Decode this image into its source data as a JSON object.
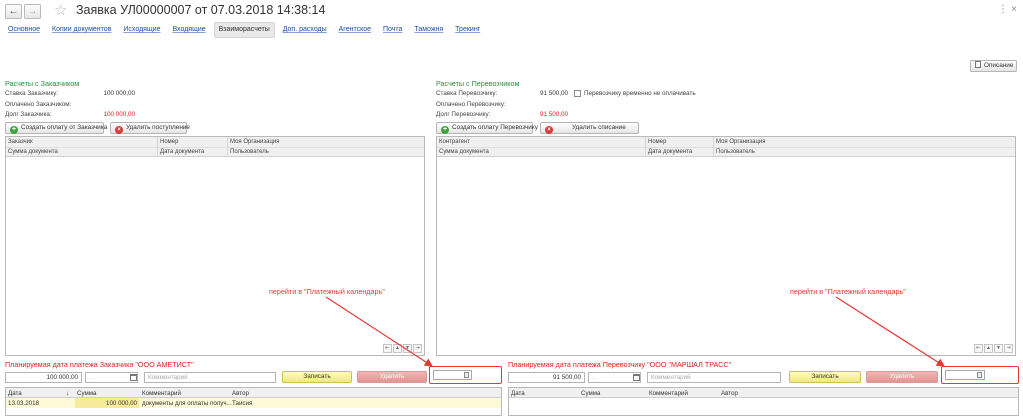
{
  "header": {
    "back_icon": "arrow-left-icon",
    "forward_icon": "arrow-right-icon",
    "title": "Заявка УЛ00000007 от 07.03.2018 14:38:14",
    "more_glyph": "⋮",
    "close_glyph": "×"
  },
  "tabs": [
    {
      "label": "Основное"
    },
    {
      "label": "Копии документов"
    },
    {
      "label": "Исходящие"
    },
    {
      "label": "Входящие"
    },
    {
      "label": "Взаиморасчеты",
      "active": true
    },
    {
      "label": "Доп. расходы"
    },
    {
      "label": "Агентское"
    },
    {
      "label": "Почта"
    },
    {
      "label": "Таможня"
    },
    {
      "label": "Трекинг"
    }
  ],
  "description_button": "Описание",
  "left": {
    "title": "Расчеты с Заказчиком",
    "rate_label": "Ставка Заказчику:",
    "rate_value": "100 000,00",
    "paid_label": "Оплачено Заказчиком:",
    "paid_value": "",
    "debt_label": "Долг Заказчика:",
    "debt_value": "100 000,00",
    "create_button": "Создать оплату от Заказчика",
    "delete_button": "Удалить поступление",
    "columns_top": [
      "Заказчик",
      "Номер",
      "Моя Организация"
    ],
    "columns_bottom": [
      "Сумма документа",
      "Дата документа",
      "Пользователь"
    ]
  },
  "right": {
    "title": "Расчеты с Перевозчиком",
    "rate_label": "Ставка Перевозчику:",
    "rate_value": "91 500,00",
    "checkbox_label": "Перевозчику временно не оплачивать",
    "paid_label": "Оплачено Перевозчику:",
    "paid_value": "",
    "debt_label": "Долг Перевозчику:",
    "debt_value": "91 500,00",
    "create_button": "Создать оплату Перевозчику",
    "delete_button": "Удалить списание",
    "columns_top": [
      "Контрагент",
      "Номер",
      "Моя Организация"
    ],
    "columns_bottom": [
      "Сумма документа",
      "Дата документа",
      "Пользователь"
    ]
  },
  "table_nav": [
    "⇤",
    "▲",
    "▼",
    "⇥"
  ],
  "annotations": {
    "left": "перейти в \"Платежный календарь\"",
    "right": "перейти в \"Платежный календарь\""
  },
  "pay_left": {
    "title": "Планируемая дата платежа Заказчика \"ООО АМЕТИСТ\"",
    "amount": "100 000,00",
    "date_placeholder": ". .",
    "comment_placeholder": "Комментарий",
    "save_button": "Записать",
    "delete_button": "Удалить",
    "columns": [
      "Дата",
      "Сумма",
      "Комментарий",
      "Автор"
    ],
    "sort_glyph": "↓",
    "rows": [
      {
        "date": "13.03.2018",
        "sum": "100 000,00",
        "comment": "документы для оплаты получ...",
        "author": "Таисия"
      }
    ]
  },
  "pay_right": {
    "title": "Планируемая дата платежа Перевозчику \"ООО \"МАРШАЛ ТРАСС\"",
    "amount": "91 500,00",
    "date_placeholder": ". .",
    "comment_placeholder": "Комментарий",
    "save_button": "Записать",
    "delete_button": "Удалить",
    "columns": [
      "Дата",
      "Сумма",
      "Комментарий",
      "Автор"
    ]
  },
  "colors": {
    "accent_green": "#2e8b3d",
    "alert_red": "#e02020",
    "link_blue": "#1a4ea0"
  }
}
